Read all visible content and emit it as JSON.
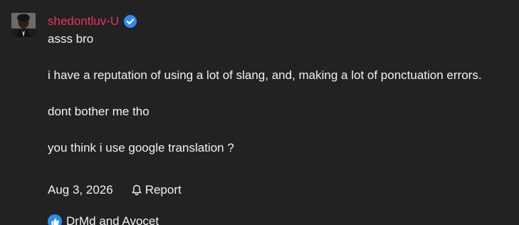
{
  "theme": {
    "background": "#222222",
    "name_color": "#e8345f",
    "verified_color": "#2d8cf0",
    "like_color": "#2d8cf0"
  },
  "post": {
    "author": "shedontluv-U",
    "author_verified": true,
    "author_avatar": "user-avatar",
    "paragraphs": [
      "asss bro",
      "i have a reputation of using a lot of slang, and, making a lot of ponctuation errors.",
      "dont bother me tho",
      "you think i use google translation ?"
    ],
    "date": "Aug 3, 2026",
    "report_label": "Report",
    "report_icon": "bell-icon",
    "reactions_icon": "thumbs-up-icon",
    "reactions_text": "DrMd and Avocet"
  }
}
